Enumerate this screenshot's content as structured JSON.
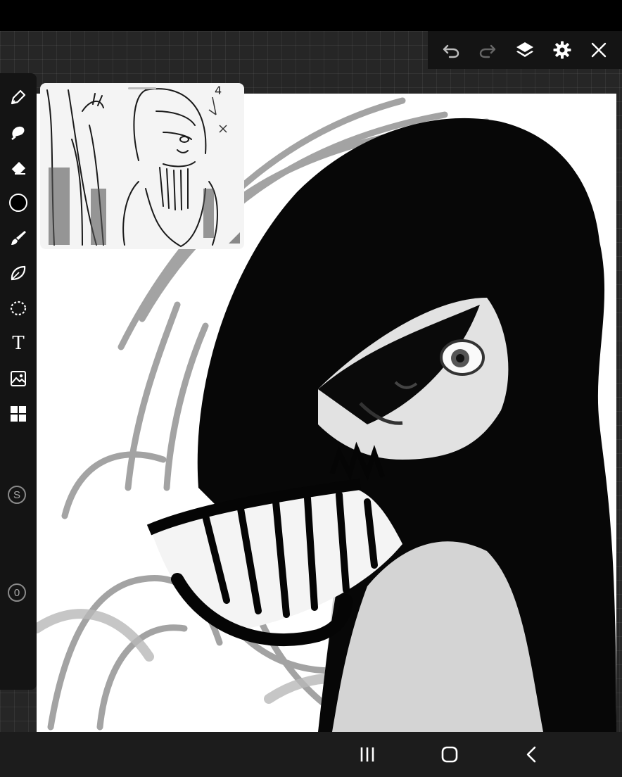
{
  "app": {
    "colors": {
      "toolbar_bg": "#141414",
      "workspace_bg": "#262626",
      "canvas_bg": "#ffffff",
      "nav_bg": "#1c1c1c",
      "icon": "#ffffff",
      "current_brush_color": "#000000"
    }
  },
  "top_toolbar": {
    "icons": [
      "undo-icon",
      "redo-icon",
      "layers-icon",
      "gear-icon",
      "close-icon"
    ]
  },
  "left_toolbar": {
    "tools": [
      "pen-icon",
      "smudge-icon",
      "eraser-icon",
      "color-swatch",
      "brush-icon",
      "shape-icon",
      "lasso-icon",
      "text-icon",
      "image-icon",
      "grid-icon"
    ],
    "text_tool_label": "T",
    "brush_size_label": "S",
    "opacity_label": "0"
  },
  "reference_window": {
    "handwritten_label": "4"
  },
  "nav_bar": {
    "icons": [
      "recents-icon",
      "home-icon",
      "back-icon"
    ]
  }
}
